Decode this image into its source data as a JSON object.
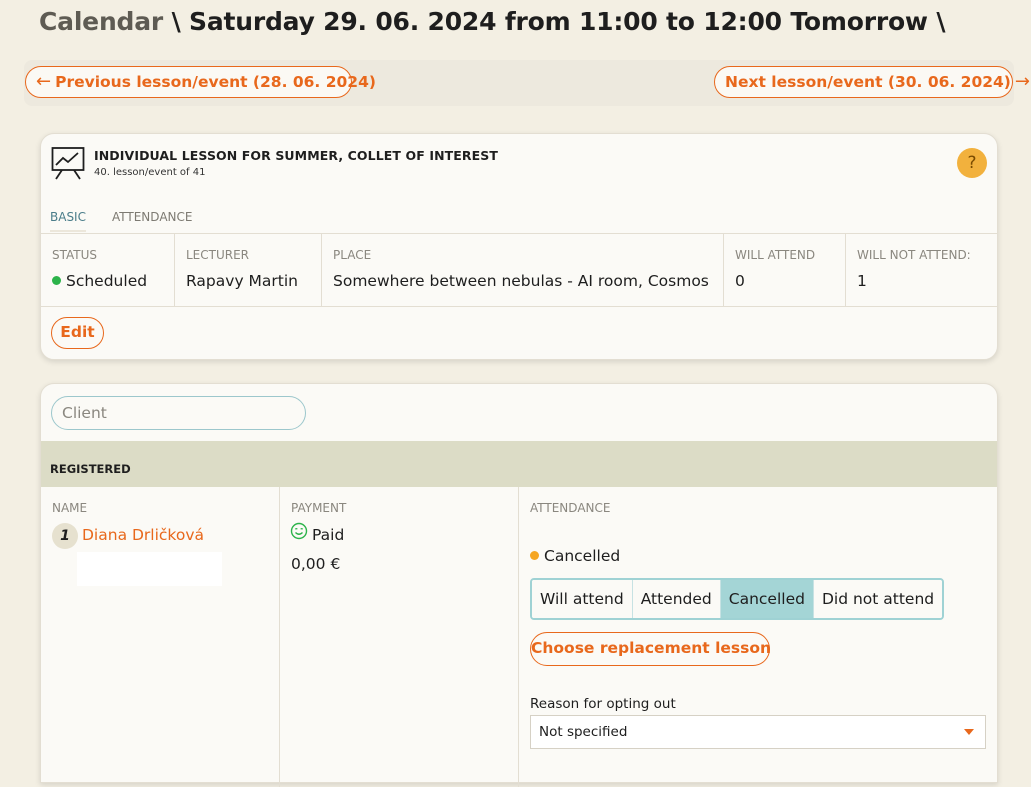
{
  "heading": {
    "crumb": "Calendar",
    "separator": "\\",
    "current": "Saturday 29. 06. 2024 from 11:00 to 12:00 Tomorrow",
    "trailing": "\\"
  },
  "nav": {
    "prev_label": "Previous lesson/event (28. 06. 2024)",
    "next_label": "Next lesson/event (30. 06. 2024)",
    "prev_arrow": "←",
    "next_arrow": "→"
  },
  "lesson": {
    "icon": "presentation-board-icon",
    "title": "INDIVIDUAL LESSON FOR SUMMER, COLLET OF INTEREST",
    "subtitle": "40. lesson/event of 41",
    "help": "?",
    "tabs": [
      {
        "label": "BASIC",
        "active": true
      },
      {
        "label": "ATTENDANCE",
        "active": false
      }
    ],
    "info": [
      {
        "label": "STATUS",
        "value": "Scheduled"
      },
      {
        "label": "LECTURER",
        "value": "Rapavy Martin"
      },
      {
        "label": "PLACE",
        "value": "Somewhere between nebulas - AI room, Cosmos"
      },
      {
        "label": "WILL ATTEND",
        "value": "0"
      },
      {
        "label": "WILL NOT ATTEND:",
        "value": "1"
      }
    ],
    "edit_label": "Edit",
    "status_color": "#2cb34a"
  },
  "registration": {
    "client_placeholder": "Client",
    "section_title": "REGISTERED",
    "columns": [
      "NAME",
      "PAYMENT",
      "ATTENDANCE"
    ],
    "client": {
      "number": "1",
      "name": "Diana Drličková",
      "payment_icon": "smile-icon",
      "payment_status": "Paid",
      "price": "0,00 €",
      "attendance_status": "Cancelled",
      "attendance_color": "#f5a623",
      "options": [
        "Will attend",
        "Attended",
        "Cancelled",
        "Did not attend"
      ],
      "selected_option": "Cancelled",
      "replacement_label": "Choose replacement lesson",
      "reason_label": "Reason for opting out",
      "reason_value": "Not specified"
    }
  },
  "colors": {
    "accent": "#e8681c",
    "background": "#f3efe3",
    "section_bar": "#dcdcc6",
    "segment_active": "#a4d5d6",
    "help": "#f2b13d"
  }
}
